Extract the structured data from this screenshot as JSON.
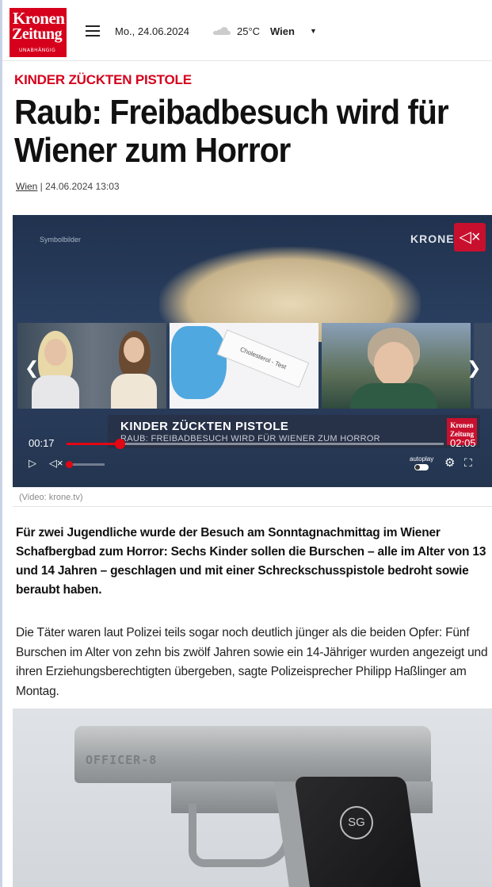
{
  "header": {
    "logo_line1": "Kronen",
    "logo_line2": "Zeitung",
    "logo_tagline": "UNABHÄNGIG",
    "date": "Mo., 24.06.2024",
    "weather_icon": "cloud-icon",
    "temperature": "25°C",
    "city": "Wien"
  },
  "article": {
    "kicker": "KINDER ZÜCKTEN PISTOLE",
    "headline": "Raub: Freibadbesuch wird für Wiener zum Horror",
    "meta_city": "Wien",
    "meta_sep": " | ",
    "meta_datetime": "24.06.2024 13:03",
    "lead": "Für zwei Jugendliche wurde der Besuch am Sonntagnachmittag im Wiener Schafbergbad zum Horror: Sechs Kinder sollen die Burschen – alle im Alter von 13 und 14 Jahren –  geschlagen und mit einer Schreckschusspistole bedroht sowie beraubt haben.",
    "body": "Die Täter waren laut Polizei teils sogar noch deutlich jünger als die beiden Opfer: Fünf Burschen im Alter von zehn bis zwölf Jahren sowie ein 14-Jähriger wurden angezeigt und ihren Erziehungsberechtigten übergeben, sagte Polizeisprecher Philipp Haßlinger am Montag."
  },
  "video": {
    "symbol_label": "Symbolbilder",
    "channel_logo": "KRONE",
    "thumb2_label": "Cholesterol - Test",
    "lower_third_title": "KINDER ZÜCKTEN PISTOLE",
    "lower_third_sub": "RAUB: FREIBADBESUCH WIRD FÜR WIENER ZUM HORROR",
    "lower_third_logo": "Kronen Zeitung",
    "current_time": "00:17",
    "duration": "02:05",
    "progress_fraction": 0.14,
    "autoplay_label": "autoplay",
    "caption": "(Video: krone.tv)"
  },
  "photo": {
    "engraving": "OFFICER-8",
    "badge": "SG"
  },
  "colors": {
    "brand_red": "#d6001c",
    "video_red": "#e30613"
  }
}
